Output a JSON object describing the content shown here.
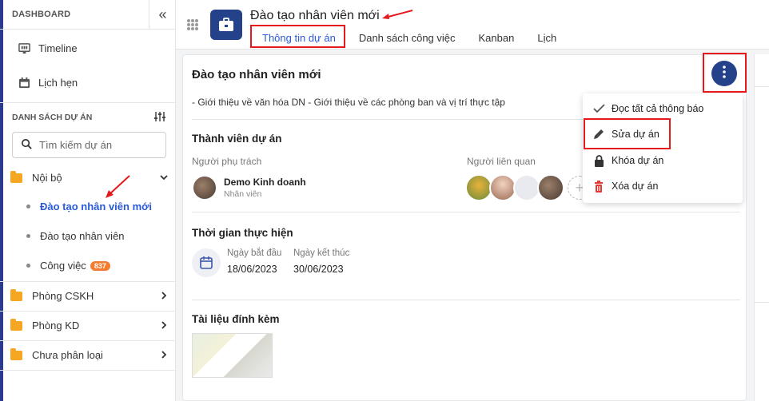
{
  "sidebar": {
    "heading": "DASHBOARD",
    "collapse_icon": "double-chevron-left-icon",
    "nav": [
      {
        "label": "Timeline",
        "icon": "timeline-icon"
      },
      {
        "label": "Lịch hẹn",
        "icon": "calendar-icon"
      }
    ],
    "section_title": "DANH SÁCH DỰ ÁN",
    "filter_icon": "sliders-icon",
    "search_placeholder": "Tìm kiếm dự án",
    "groups": {
      "noi_bo": "Nội bộ",
      "phong_cskh": "Phòng CSKH",
      "phong_kd": "Phòng KD",
      "chua_phan_loai": "Chưa phân loại"
    },
    "sub_items": {
      "active": "Đào tạo nhân viên mới",
      "second": "Đào tạo nhân viên",
      "third": "Công việc",
      "third_badge": "837"
    }
  },
  "header": {
    "title": "Đào tạo nhân viên mới",
    "tabs": [
      "Thông tin dự án",
      "Danh sách công việc",
      "Kanban",
      "Lịch"
    ],
    "active_tab_index": 0
  },
  "card": {
    "title": "Đào tạo nhân viên mới",
    "description": "- Giới thiệu về văn hóa DN - Giới thiệu về các phòng ban và vị trí thực tập",
    "members_title": "Thành viên dự án",
    "owner_label": "Người phụ trách",
    "owner_name": "Demo Kinh doanh",
    "owner_role": "Nhân viên",
    "related_label": "Người liên quan",
    "time_title": "Thời gian thực hiện",
    "start_label": "Ngày bắt đầu",
    "start_value": "18/06/2023",
    "end_label": "Ngày kết thúc",
    "end_value": "30/06/2023",
    "attachments_title": "Tài liệu đính kèm"
  },
  "menu": {
    "items": [
      {
        "label": "Đọc tất cả thông báo",
        "icon": "check-icon"
      },
      {
        "label": "Sửa dự án",
        "icon": "pencil-icon"
      },
      {
        "label": "Khóa dự án",
        "icon": "lock-icon"
      },
      {
        "label": "Xóa dự án",
        "icon": "trash-icon"
      }
    ]
  },
  "colors": {
    "brand": "#24428a",
    "active_link": "#2a5bd7",
    "folder": "#f5a623",
    "badge": "#f47c31",
    "annotation": "#e5191c",
    "delete": "#e53935"
  }
}
